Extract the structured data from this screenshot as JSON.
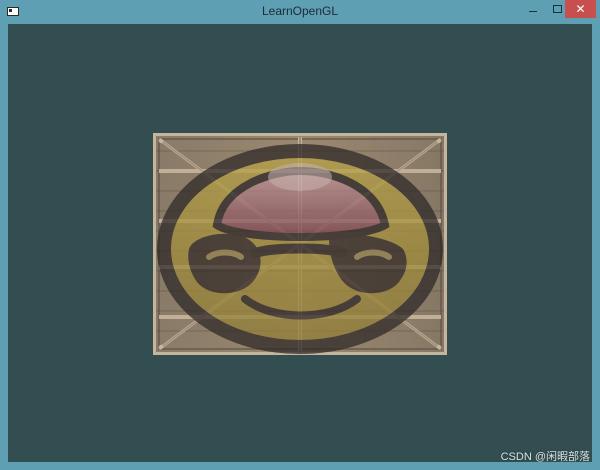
{
  "window": {
    "title": "LearnOpenGL",
    "controls": {
      "minimize_icon": "minimize-icon",
      "maximize_icon": "maximize-icon",
      "close_icon": "close-icon"
    },
    "colors": {
      "frame": "#5f9fb4",
      "clear": "#324e50",
      "close": "#c7504e"
    }
  },
  "scene": {
    "textures": [
      "wooden-container-texture",
      "awesomeface-texture"
    ]
  },
  "watermark": {
    "text": "CSDN @闲暇部落"
  }
}
